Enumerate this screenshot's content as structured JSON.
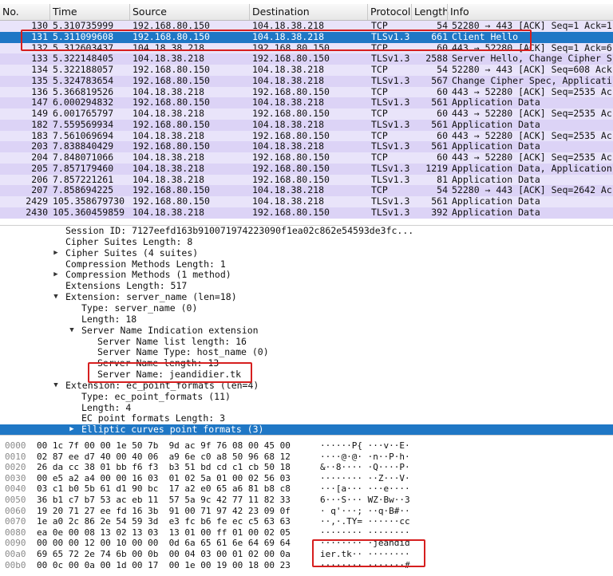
{
  "packet_list": {
    "columns": [
      "No.",
      "Time",
      "Source",
      "Destination",
      "Protocol",
      "Length",
      "Info"
    ],
    "rows": [
      {
        "no": "130",
        "time": "5.310735999",
        "src": "192.168.80.150",
        "dst": "104.18.38.218",
        "proto": "TCP",
        "len": "54",
        "info": "52280 → 443 [ACK] Seq=1 Ack=1"
      },
      {
        "no": "131",
        "time": "5.311099608",
        "src": "192.168.80.150",
        "dst": "104.18.38.218",
        "proto": "TLSv1.3",
        "len": "661",
        "info": "Client Hello"
      },
      {
        "no": "132",
        "time": "5.312603437",
        "src": "104.18.38.218",
        "dst": "192.168.80.150",
        "proto": "TCP",
        "len": "60",
        "info": "443 → 52280 [ACK] Seq=1 Ack=6"
      },
      {
        "no": "133",
        "time": "5.322148405",
        "src": "104.18.38.218",
        "dst": "192.168.80.150",
        "proto": "TLSv1.3",
        "len": "2588",
        "info": "Server Hello, Change Cipher S"
      },
      {
        "no": "134",
        "time": "5.322188057",
        "src": "192.168.80.150",
        "dst": "104.18.38.218",
        "proto": "TCP",
        "len": "54",
        "info": "52280 → 443 [ACK] Seq=608 Ack"
      },
      {
        "no": "135",
        "time": "5.324783654",
        "src": "192.168.80.150",
        "dst": "104.18.38.218",
        "proto": "TLSv1.3",
        "len": "567",
        "info": "Change Cipher Spec, Applicati"
      },
      {
        "no": "136",
        "time": "5.366819526",
        "src": "104.18.38.218",
        "dst": "192.168.80.150",
        "proto": "TCP",
        "len": "60",
        "info": "443 → 52280 [ACK] Seq=2535 Ac"
      },
      {
        "no": "147",
        "time": "6.000294832",
        "src": "192.168.80.150",
        "dst": "104.18.38.218",
        "proto": "TLSv1.3",
        "len": "561",
        "info": "Application Data"
      },
      {
        "no": "149",
        "time": "6.001765797",
        "src": "104.18.38.218",
        "dst": "192.168.80.150",
        "proto": "TCP",
        "len": "60",
        "info": "443 → 52280 [ACK] Seq=2535 Ac"
      },
      {
        "no": "182",
        "time": "7.559569934",
        "src": "192.168.80.150",
        "dst": "104.18.38.218",
        "proto": "TLSv1.3",
        "len": "561",
        "info": "Application Data"
      },
      {
        "no": "183",
        "time": "7.561069694",
        "src": "104.18.38.218",
        "dst": "192.168.80.150",
        "proto": "TCP",
        "len": "60",
        "info": "443 → 52280 [ACK] Seq=2535 Ac"
      },
      {
        "no": "203",
        "time": "7.838840429",
        "src": "192.168.80.150",
        "dst": "104.18.38.218",
        "proto": "TLSv1.3",
        "len": "561",
        "info": "Application Data"
      },
      {
        "no": "204",
        "time": "7.848071066",
        "src": "104.18.38.218",
        "dst": "192.168.80.150",
        "proto": "TCP",
        "len": "60",
        "info": "443 → 52280 [ACK] Seq=2535 Ac"
      },
      {
        "no": "205",
        "time": "7.857179460",
        "src": "104.18.38.218",
        "dst": "192.168.80.150",
        "proto": "TLSv1.3",
        "len": "1219",
        "info": "Application Data, Application"
      },
      {
        "no": "206",
        "time": "7.857221261",
        "src": "104.18.38.218",
        "dst": "192.168.80.150",
        "proto": "TLSv1.3",
        "len": "81",
        "info": "Application Data"
      },
      {
        "no": "207",
        "time": "7.858694225",
        "src": "192.168.80.150",
        "dst": "104.18.38.218",
        "proto": "TCP",
        "len": "54",
        "info": "52280 → 443 [ACK] Seq=2642 Ac"
      },
      {
        "no": "2429",
        "time": "105.358679730",
        "src": "192.168.80.150",
        "dst": "104.18.38.218",
        "proto": "TLSv1.3",
        "len": "561",
        "info": "Application Data"
      },
      {
        "no": "2430",
        "time": "105.360459859",
        "src": "104.18.38.218",
        "dst": "192.168.80.150",
        "proto": "TLSv1.3",
        "len": "392",
        "info": "Application Data"
      }
    ]
  },
  "details": {
    "rows": [
      {
        "text": "Session ID: 7127eefd163b910071974223090f1ea02c862e54593de3fc...",
        "expander": ""
      },
      {
        "text": "Cipher Suites Length: 8",
        "expander": ""
      },
      {
        "text": "Cipher Suites (4 suites)",
        "expander": "collapsed"
      },
      {
        "text": "Compression Methods Length: 1",
        "expander": ""
      },
      {
        "text": "Compression Methods (1 method)",
        "expander": "collapsed"
      },
      {
        "text": "Extensions Length: 517",
        "expander": ""
      },
      {
        "text": "Extension: server_name (len=18)",
        "expander": "expanded"
      },
      {
        "text": "Type: server_name (0)",
        "expander": ""
      },
      {
        "text": "Length: 18",
        "expander": ""
      },
      {
        "text": "Server Name Indication extension",
        "expander": "expanded"
      },
      {
        "text": "Server Name list length: 16",
        "expander": ""
      },
      {
        "text": "Server Name Type: host_name (0)",
        "expander": ""
      },
      {
        "text": "Server Name length: 13",
        "expander": ""
      },
      {
        "text": "Server Name: jeandidier.tk",
        "expander": ""
      },
      {
        "text": "Extension: ec_point_formats (len=4)",
        "expander": "expanded"
      },
      {
        "text": "Type: ec_point_formats (11)",
        "expander": ""
      },
      {
        "text": "Length: 4",
        "expander": ""
      },
      {
        "text": "EC point formats Length: 3",
        "expander": ""
      },
      {
        "text": "Elliptic curves point formats (3)",
        "expander": "collapsed"
      }
    ]
  },
  "bytes": {
    "rows": [
      {
        "offset": "0000",
        "hex": "00 1c 7f 00 00 1e 50 7b  9d ac 9f 76 08 00 45 00",
        "ascii": "······P{ ···v··E·"
      },
      {
        "offset": "0010",
        "hex": "02 87 ee d7 40 00 40 06  a9 6e c0 a8 50 96 68 12",
        "ascii": "····@·@· ·n··P·h·"
      },
      {
        "offset": "0020",
        "hex": "26 da cc 38 01 bb f6 f3  b3 51 bd cd c1 cb 50 18",
        "ascii": "&··8···· ·Q····P·"
      },
      {
        "offset": "0030",
        "hex": "00 e5 a2 a4 00 00 16 03  01 02 5a 01 00 02 56 03",
        "ascii": "········ ··Z···V·"
      },
      {
        "offset": "0040",
        "hex": "03 c1 b0 5b 61 d1 90 bc  17 a2 e0 65 a6 81 b8 c8",
        "ascii": "···[a··· ···e····"
      },
      {
        "offset": "0050",
        "hex": "36 b1 c7 b7 53 ac eb 11  57 5a 9c 42 77 11 82 33",
        "ascii": "6···S··· WZ·Bw··3"
      },
      {
        "offset": "0060",
        "hex": "19 20 71 27 ee fd 16 3b  91 00 71 97 42 23 09 0f",
        "ascii": "· q'···; ··q·B#··"
      },
      {
        "offset": "0070",
        "hex": "1e a0 2c 86 2e 54 59 3d  e3 fc b6 fe ec c5 63 63",
        "ascii": "··,·.TY= ······cc"
      },
      {
        "offset": "0080",
        "hex": "ea 0e 00 08 13 02 13 03  13 01 00 ff 01 00 02 05",
        "ascii": "········ ········"
      },
      {
        "offset": "0090",
        "hex": "00 00 00 12 00 10 00 00  0d 6a 65 61 6e 64 69 64",
        "ascii": "········ ·jeandid"
      },
      {
        "offset": "00a0",
        "hex": "69 65 72 2e 74 6b 00 0b  00 04 03 00 01 02 00 0a",
        "ascii": "ier.tk·· ········"
      },
      {
        "offset": "00b0",
        "hex": "00 0c 00 0a 00 1d 00 17  00 1e 00 19 00 18 00 23",
        "ascii": "········ ·······#"
      }
    ]
  },
  "colors": {
    "selection": "#1f77c5",
    "row_odd": "#e9e4fa",
    "row_even": "#dcd3f6",
    "highlight_box": "#d61f1f",
    "offset_text": "#8a8a8a"
  }
}
